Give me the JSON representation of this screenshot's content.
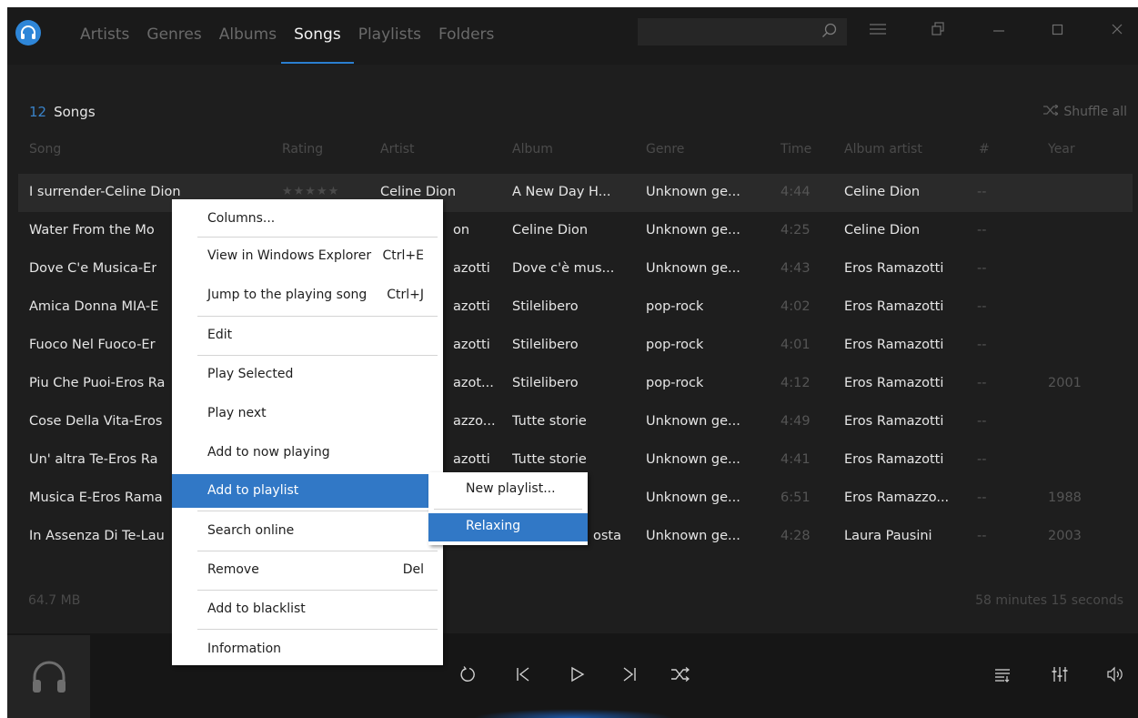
{
  "tabs": [
    {
      "label": "Artists"
    },
    {
      "label": "Genres"
    },
    {
      "label": "Albums"
    },
    {
      "label": "Songs"
    },
    {
      "label": "Playlists"
    },
    {
      "label": "Folders"
    }
  ],
  "search": {
    "value": "",
    "placeholder": ""
  },
  "header": {
    "count": "12",
    "label": "Songs",
    "shuffle_all": "Shuffle all"
  },
  "columns": {
    "song": "Song",
    "rating": "Rating",
    "artist": "Artist",
    "album": "Album",
    "genre": "Genre",
    "time": "Time",
    "album_artist": "Album artist",
    "number": "#",
    "year": "Year"
  },
  "rows": [
    {
      "song": "I surrender-Celine Dion",
      "rating": "★★★★★",
      "artist": "Celine Dion",
      "album": "A New Day H...",
      "genre": "Unknown ge...",
      "time": "4:44",
      "album_artist": "Celine Dion",
      "number": "--",
      "year": ""
    },
    {
      "song": "Water From the Mo",
      "rating": "",
      "artist": "on",
      "album": "Celine Dion",
      "genre": "Unknown ge...",
      "time": "4:25",
      "album_artist": "Celine Dion",
      "number": "--",
      "year": ""
    },
    {
      "song": "Dove C'e Musica-Er",
      "rating": "",
      "artist": "azotti",
      "album": "Dove c'è mus...",
      "genre": "Unknown ge...",
      "time": "4:43",
      "album_artist": "Eros Ramazotti",
      "number": "--",
      "year": ""
    },
    {
      "song": "Amica Donna MIA-E",
      "rating": "",
      "artist": "azotti",
      "album": "Stilelibero",
      "genre": "pop-rock",
      "time": "4:02",
      "album_artist": "Eros Ramazotti",
      "number": "--",
      "year": ""
    },
    {
      "song": "Fuoco Nel Fuoco-Er",
      "rating": "",
      "artist": "azotti",
      "album": "Stilelibero",
      "genre": "pop-rock",
      "time": "4:01",
      "album_artist": "Eros Ramazotti",
      "number": "--",
      "year": ""
    },
    {
      "song": "Piu Che Puoi-Eros Ra",
      "rating": "",
      "artist": "azot...",
      "album": "Stilelibero",
      "genre": "pop-rock",
      "time": "4:12",
      "album_artist": "Eros Ramazotti",
      "number": "--",
      "year": "2001"
    },
    {
      "song": "Cose Della Vita-Eros",
      "rating": "",
      "artist": "azzo...",
      "album": "Tutte storie",
      "genre": "Unknown ge...",
      "time": "4:49",
      "album_artist": "Eros Ramazotti",
      "number": "--",
      "year": ""
    },
    {
      "song": "Un' altra Te-Eros Ra",
      "rating": "",
      "artist": "azotti",
      "album": "Tutte storie",
      "genre": "Unknown ge...",
      "time": "4:41",
      "album_artist": "Eros Ramazotti",
      "number": "--",
      "year": ""
    },
    {
      "song": "Musica E-Eros Rama",
      "rating": "",
      "artist": "",
      "album": "",
      "genre": "Unknown ge...",
      "time": "6:51",
      "album_artist": "Eros Ramazzo...",
      "number": "--",
      "year": "1988"
    },
    {
      "song": "In Assenza Di Te-Lau",
      "rating": "",
      "artist": "",
      "album": "osta",
      "genre": "Unknown ge...",
      "time": "4:28",
      "album_artist": "Laura Pausini",
      "number": "--",
      "year": "2003"
    }
  ],
  "status": {
    "size": "64.7 MB",
    "duration": "58 minutes 15 seconds"
  },
  "context_menu": {
    "items": [
      {
        "label": "Columns...",
        "shortcut": ""
      },
      {
        "label": "View in Windows Explorer",
        "shortcut": "Ctrl+E"
      },
      {
        "label": "Jump to the playing song",
        "shortcut": "Ctrl+J"
      },
      {
        "label": "Edit",
        "shortcut": ""
      },
      {
        "label": "Play Selected",
        "shortcut": ""
      },
      {
        "label": "Play next",
        "shortcut": ""
      },
      {
        "label": "Add to now playing",
        "shortcut": ""
      },
      {
        "label": "Add to playlist",
        "shortcut": ""
      },
      {
        "label": "Search online",
        "shortcut": ""
      },
      {
        "label": "Remove",
        "shortcut": "Del"
      },
      {
        "label": "Add to blacklist",
        "shortcut": ""
      },
      {
        "label": "Information",
        "shortcut": ""
      }
    ]
  },
  "submenu": {
    "items": [
      {
        "label": "New playlist..."
      },
      {
        "label": "Relaxing"
      }
    ]
  },
  "colors": {
    "accent": "#3178c6",
    "tab_indicator": "#2b7fd0",
    "background": "#1d1d1d"
  }
}
